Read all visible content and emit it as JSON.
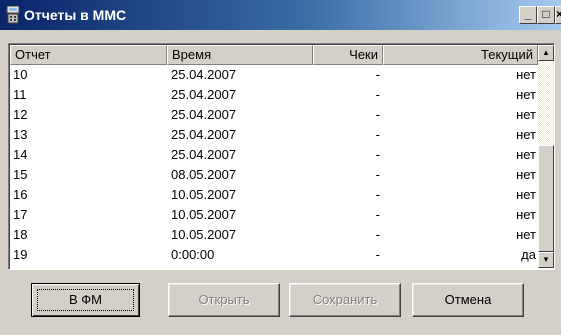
{
  "window": {
    "title": "Отчеты в ММС",
    "icon": "app-register-icon"
  },
  "window_buttons": {
    "minimize": "_",
    "maximize": "□",
    "close": "×"
  },
  "table": {
    "columns": [
      "Отчет",
      "Время",
      "Чеки",
      "Текущий"
    ],
    "rows": [
      [
        "10",
        "25.04.2007",
        "-",
        "нет"
      ],
      [
        "11",
        "25.04.2007",
        "-",
        "нет"
      ],
      [
        "12",
        "25.04.2007",
        "-",
        "нет"
      ],
      [
        "13",
        "25.04.2007",
        "-",
        "нет"
      ],
      [
        "14",
        "25.04.2007",
        "-",
        "нет"
      ],
      [
        "15",
        "08.05.2007",
        "-",
        "нет"
      ],
      [
        "16",
        "10.05.2007",
        "-",
        "нет"
      ],
      [
        "17",
        "10.05.2007",
        "-",
        "нет"
      ],
      [
        "18",
        "10.05.2007",
        "-",
        "нет"
      ],
      [
        "19",
        "0:00:00",
        "-",
        "да"
      ]
    ]
  },
  "scrollbar": {
    "up": "▲",
    "down": "▼"
  },
  "buttons": {
    "to_fm": "В ФМ",
    "open": "Открыть",
    "save": "Сохранить",
    "cancel": "Отмена"
  }
}
